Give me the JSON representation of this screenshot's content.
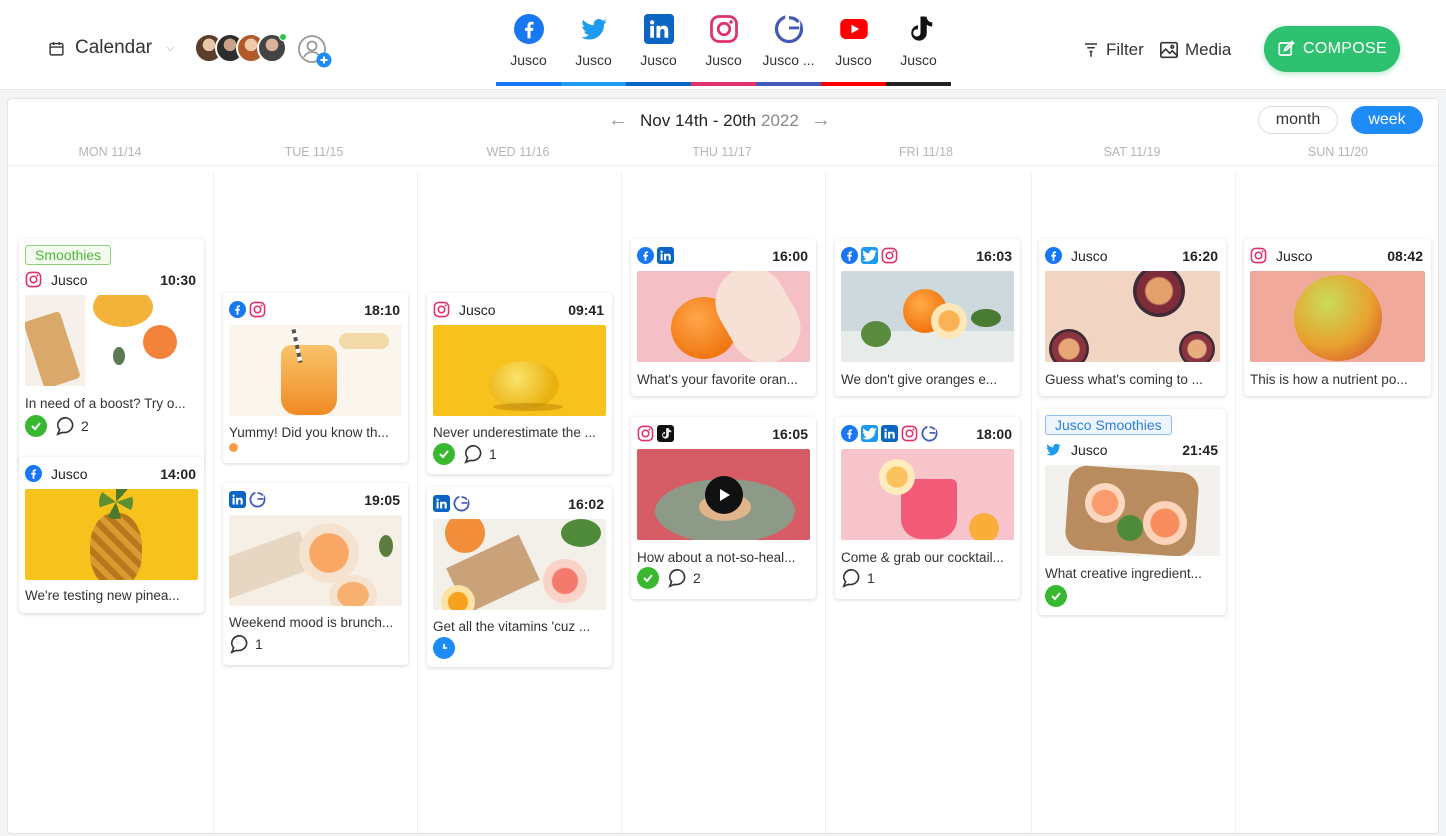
{
  "header": {
    "calendar_label": "Calendar",
    "networks": [
      {
        "label": "Jusco",
        "icon": "facebook-icon",
        "color": "#1877f2"
      },
      {
        "label": "Jusco",
        "icon": "twitter-icon",
        "color": "#1d9bf0"
      },
      {
        "label": "Jusco",
        "icon": "linkedin-icon",
        "color": "#0a66c2"
      },
      {
        "label": "Jusco",
        "icon": "instagram-icon",
        "color": "#e1306c"
      },
      {
        "label": "Jusco ...",
        "icon": "google-business-icon",
        "color": "#4459b8"
      },
      {
        "label": "Jusco",
        "icon": "youtube-icon",
        "color": "#ff0000"
      },
      {
        "label": "Jusco",
        "icon": "tiktok-icon",
        "color": "#111111"
      }
    ],
    "filter_label": "Filter",
    "media_label": "Media",
    "compose_label": "COMPOSE"
  },
  "week": {
    "range": "Nov 14th - 20th",
    "year": "2022",
    "view_month": "month",
    "view_week": "week",
    "active_view": "week",
    "days": [
      "MON 11/14",
      "TUE 11/15",
      "WED 11/16",
      "THU 11/17",
      "FRI 11/18",
      "SAT 11/19",
      "SUN 11/20"
    ]
  },
  "posts": {
    "mon1": {
      "tag": "Smoothies",
      "page": "Jusco",
      "time": "10:30",
      "text": "In need of a boost? Try o...",
      "comments": "2"
    },
    "mon2": {
      "page": "Jusco",
      "time": "14:00",
      "text": "We're testing new pinea..."
    },
    "tue1": {
      "time": "18:10",
      "text": "Yummy! Did you know th..."
    },
    "tue2": {
      "time": "19:05",
      "text": "Weekend mood is brunch...",
      "comments": "1"
    },
    "wed1": {
      "page": "Jusco",
      "time": "09:41",
      "text": "Never underestimate the ...",
      "comments": "1"
    },
    "wed2": {
      "time": "16:02",
      "text": "Get all the vitamins 'cuz ..."
    },
    "thu1": {
      "time": "16:00",
      "text": "What's your favorite oran..."
    },
    "thu2": {
      "time": "16:05",
      "text": "How about a not-so-heal...",
      "comments": "2"
    },
    "fri1": {
      "time": "16:03",
      "text": "We don't give oranges e..."
    },
    "fri2": {
      "time": "18:00",
      "text": "Come & grab our cocktail...",
      "comments": "1"
    },
    "sat1": {
      "page": "Jusco",
      "time": "16:20",
      "text": "Guess what's coming to ..."
    },
    "sat2": {
      "tag": "Jusco Smoothies",
      "page": "Jusco",
      "time": "21:45",
      "text": "What creative ingredient..."
    },
    "sun1": {
      "page": "Jusco",
      "time": "08:42",
      "text": "This is how a nutrient po..."
    }
  },
  "colors": {
    "compose": "#2ec16f",
    "accent": "#1d8cf8",
    "approved": "#37b82f"
  }
}
